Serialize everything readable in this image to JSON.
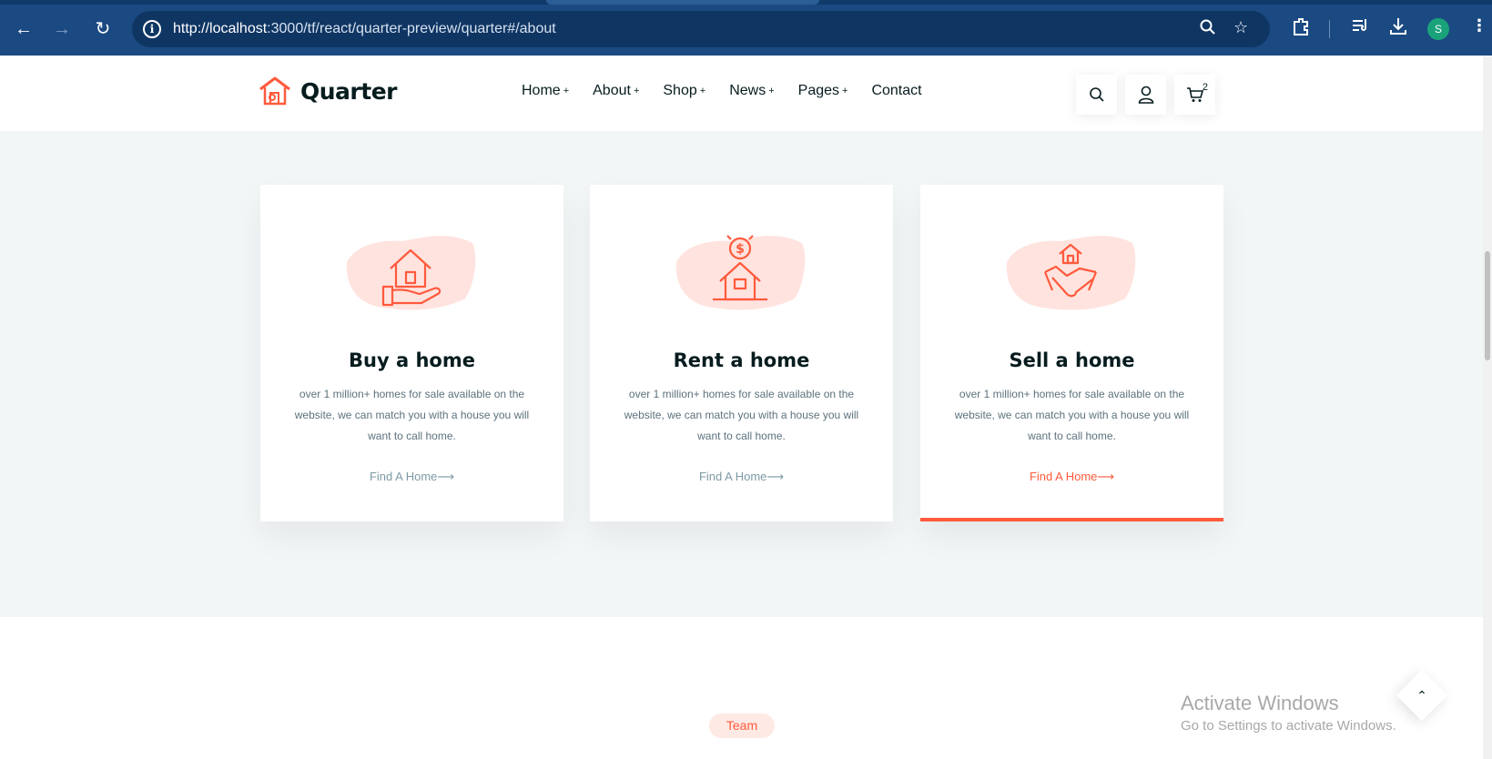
{
  "browser": {
    "url_host": "http://localhost",
    "url_rest": ":3000/tf/react/quarter-preview/quarter#/about",
    "profile_initial": "S"
  },
  "header": {
    "logo_text": "Quarter",
    "menu": [
      {
        "label": "Home",
        "plus": "+"
      },
      {
        "label": "About",
        "plus": "+"
      },
      {
        "label": "Shop",
        "plus": "+"
      },
      {
        "label": "News",
        "plus": "+"
      },
      {
        "label": "Pages",
        "plus": "+"
      },
      {
        "label": "Contact",
        "plus": ""
      }
    ],
    "cart_count": "2"
  },
  "cards": [
    {
      "title": "Buy a home",
      "text": "over 1 million+ homes for sale available on the website, we can match you with a house you will want to call home.",
      "link": "Find A Home⟶",
      "icon": "house-in-hand-icon"
    },
    {
      "title": "Rent a home",
      "text": "over 1 million+ homes for sale available on the website, we can match you with a house you will want to call home.",
      "link": "Find A Home⟶",
      "icon": "house-dollar-icon"
    },
    {
      "title": "Sell a home",
      "text": "over 1 million+ homes for sale available on the website, we can match you with a house you will want to call home.",
      "link": "Find A Home⟶",
      "icon": "handshake-house-icon"
    }
  ],
  "team_label": "Team",
  "watermark": {
    "line1": "Activate Windows",
    "line2": "Go to Settings to activate Windows."
  },
  "colors": {
    "accent": "#ff5a3c",
    "chrome": "#1b4a82",
    "heading": "#071c1f"
  }
}
